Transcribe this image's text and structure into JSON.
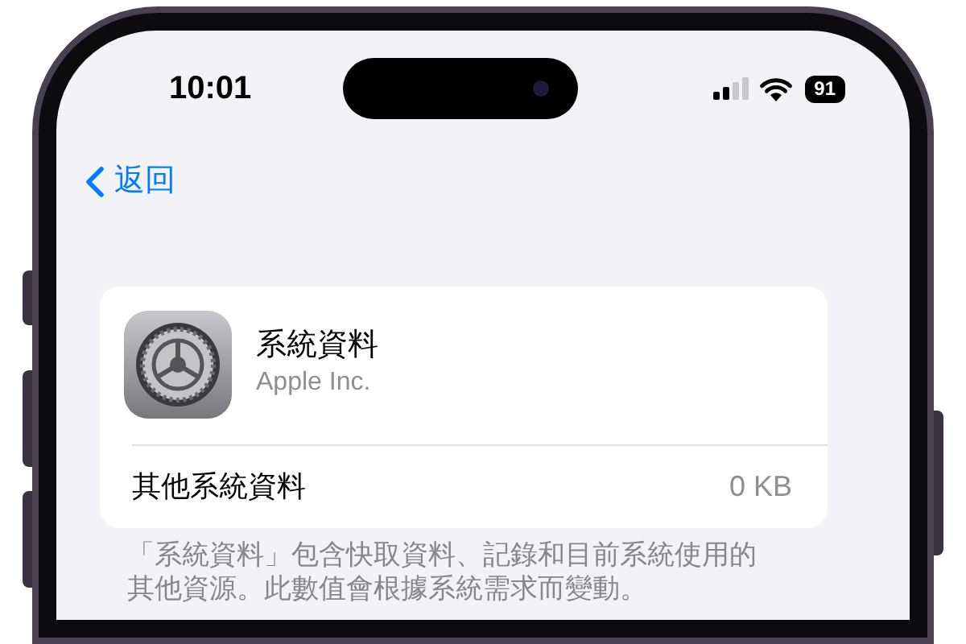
{
  "status_bar": {
    "time": "10:01",
    "battery": "91"
  },
  "nav": {
    "back": "返回"
  },
  "card": {
    "app_name": "系統資料",
    "developer": "Apple Inc.",
    "rows": [
      {
        "label": "其他系統資料",
        "value": "0 KB"
      }
    ]
  },
  "footer": "「系統資料」包含快取資料、記錄和目前系統使用的其他資源。此數值會根據系統需求而變動。"
}
